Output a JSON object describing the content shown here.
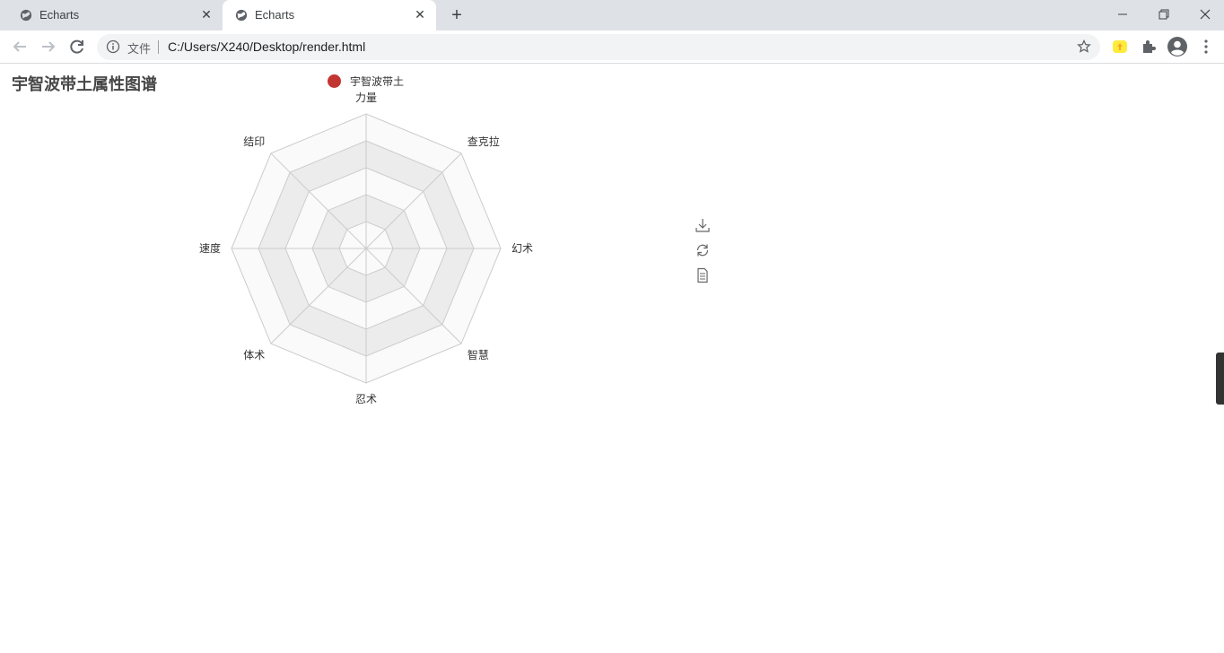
{
  "tabs": [
    {
      "label": "Echarts",
      "active": false
    },
    {
      "label": "Echarts",
      "active": true
    }
  ],
  "addressbar": {
    "security_label": "文件",
    "url": "C:/Users/X240/Desktop/render.html"
  },
  "chart": {
    "title": "宇智波带土属性图谱",
    "legend": "宇智波带土",
    "legend_color": "#c23531",
    "indicators": [
      "力量",
      "查克拉",
      "幻术",
      "智慧",
      "忍术",
      "体术",
      "速度",
      "结印"
    ],
    "toolbox": [
      "download-icon",
      "restore-icon",
      "data-view-icon"
    ]
  },
  "chart_data": {
    "type": "radar",
    "title": "宇智波带土属性图谱",
    "indicators": [
      "力量",
      "查克拉",
      "幻术",
      "智慧",
      "忍术",
      "体术",
      "速度",
      "结印"
    ],
    "series": [
      {
        "name": "宇智波带土",
        "values": []
      }
    ],
    "split_number": 5,
    "legend_position": "top-center"
  }
}
